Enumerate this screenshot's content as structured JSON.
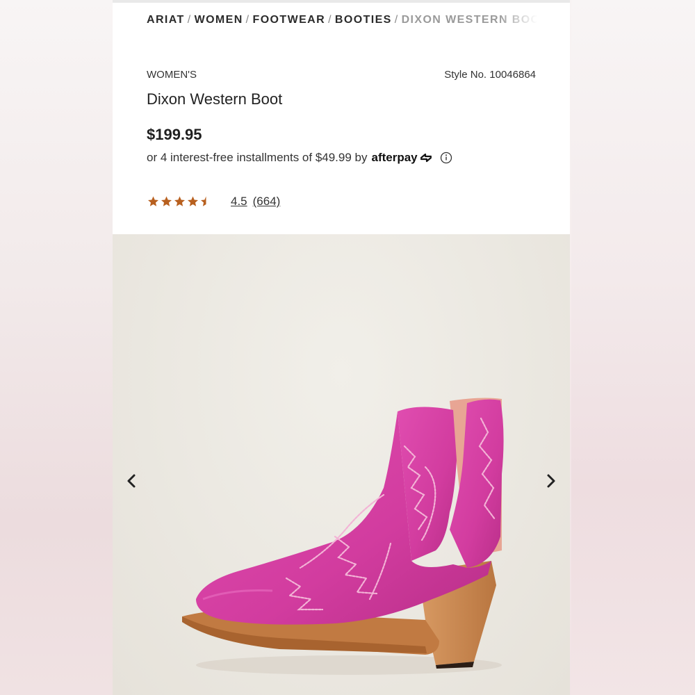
{
  "breadcrumb": {
    "items": [
      "ARIAT",
      "WOMEN",
      "FOOTWEAR",
      "BOOTIES"
    ],
    "current": "DIXON WESTERN BOOT",
    "separator": "/"
  },
  "product": {
    "gender": "WOMEN'S",
    "style_label": "Style No. 10046864",
    "name": "Dixon Western Boot",
    "price": "$199.95",
    "installment_text": "or 4 interest-free installments of $49.99 by",
    "afterpay_label": "afterpay",
    "rating_value": "4.5",
    "review_count": "(664)",
    "rating_stars": 4.5
  },
  "gallery": {
    "image_subject": "pink suede western bootie with embroidered stitching",
    "prev_icon": "chevron-left-icon",
    "next_icon": "chevron-right-icon"
  },
  "colors": {
    "star": "#b8601f",
    "boot_pink": "#d63fa6",
    "stitching": "#f1a9d0",
    "heel_wood": "#c9874f",
    "text_dark": "#222222"
  }
}
